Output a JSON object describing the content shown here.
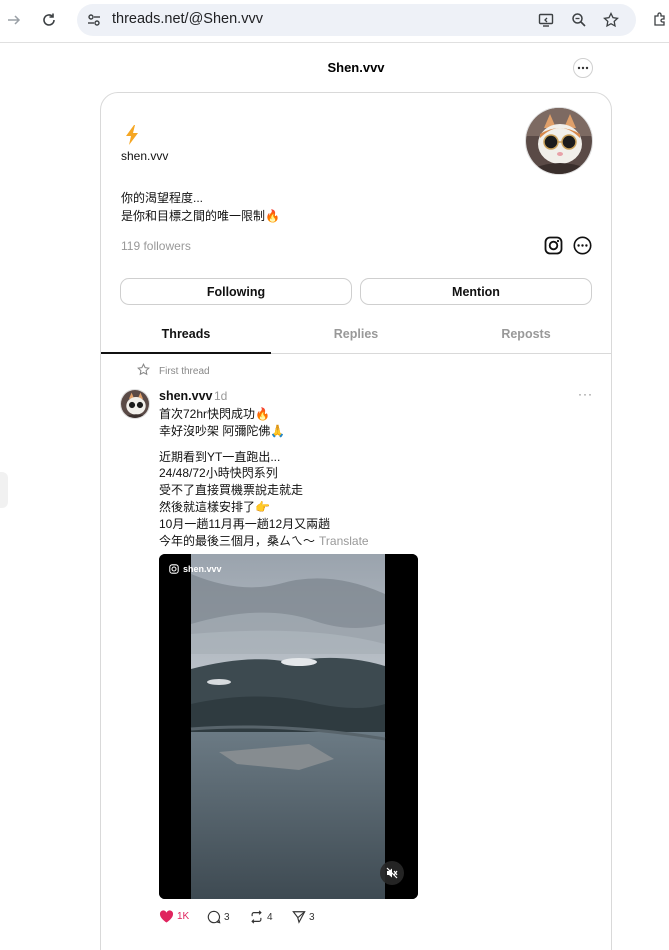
{
  "browser": {
    "url": "threads.net/@Shen.vvv"
  },
  "header": {
    "title": "Shen.vvv"
  },
  "profile": {
    "handle": "shen.vvv",
    "bio_line1": "你的渴望程度...",
    "bio_line2": "是你和目標之間的唯一限制",
    "bio_emoji": "🔥",
    "followers": "119 followers",
    "following_label": "Following",
    "mention_label": "Mention"
  },
  "tabs": [
    {
      "label": "Threads",
      "active": true
    },
    {
      "label": "Replies",
      "active": false
    },
    {
      "label": "Reposts",
      "active": false
    }
  ],
  "post": {
    "pinned_label": "First thread",
    "author": "shen.vvv",
    "time": "1d",
    "lines": [
      "首次72hr快閃成功🔥",
      "幸好沒吵架 阿彌陀佛🙏",
      "",
      "近期看到YT一直跑出...",
      "24/48/72小時快閃系列",
      "受不了直接買機票說走就走",
      "然後就這樣安排了👉",
      "10月一趟11月再一趟12月又兩趟",
      "今年的最後三個月，桑ㄙㄟ～"
    ],
    "translate_label": "Translate",
    "media_watermark": "shen.vvv",
    "likes": "1K",
    "replies": "3",
    "reposts": "4",
    "shares": "3"
  },
  "colors": {
    "like": "#e0245e",
    "bolt": "#f5a623",
    "muted": "#999999"
  }
}
